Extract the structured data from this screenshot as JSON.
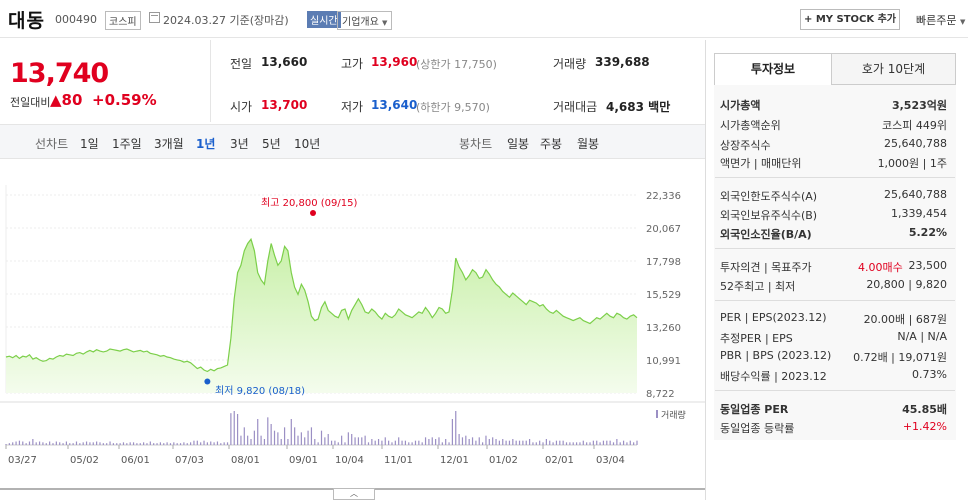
{
  "header": {
    "title": "대동",
    "code": "000490",
    "market": "코스피",
    "date": "2024.03.27 기준(장마감)",
    "realtime": "실시간",
    "overview": "기업개요",
    "my_stock": "+ MY STOCK 추가",
    "quick_order": "빠른주문"
  },
  "quote": {
    "price": "13,740",
    "change_label": "전일대비",
    "change_value": "▲80",
    "change_pct": "+0.59%",
    "prev_close_label": "전일",
    "prev_close": "13,660",
    "high_label": "고가",
    "high": "13,960",
    "upper_limit": "(상한가 17,750)",
    "volume_label": "거래량",
    "volume": "339,688",
    "open_label": "시가",
    "open": "13,700",
    "low_label": "저가",
    "low": "13,640",
    "lower_limit": "(하한가 9,570)",
    "amount_label": "거래대금",
    "amount": "4,683",
    "amount_unit": "백만"
  },
  "periods": {
    "line_label": "선차트",
    "line_items": [
      "1일",
      "1주일",
      "3개월",
      "1년",
      "3년",
      "5년",
      "10년"
    ],
    "selected": "1년",
    "candle_label": "봉차트",
    "candle_items": [
      "일봉",
      "주봉",
      "월봉"
    ]
  },
  "chart_data": {
    "type": "area",
    "y_ticks": [
      "22,336",
      "20,067",
      "17,798",
      "15,529",
      "13,260",
      "10,991",
      "8,722"
    ],
    "ylim": [
      8722,
      22336
    ],
    "x_ticks": [
      "03/27",
      "05/02",
      "06/01",
      "07/03",
      "08/01",
      "09/01",
      "10/04",
      "11/01",
      "12/01",
      "01/02",
      "02/01",
      "03/04"
    ],
    "annotation_high": "최고 20,800 (09/15)",
    "annotation_low": "최저 9,820 (08/18)",
    "volume_label": "거래량",
    "values": [
      11200,
      11250,
      11150,
      11300,
      11100,
      11250,
      11200,
      11350,
      11050,
      11150,
      11000,
      10900,
      10950,
      11100,
      11050,
      11200,
      11300,
      11250,
      11400,
      11350,
      11300,
      11450,
      11500,
      11400,
      11550,
      11650,
      11550,
      11700,
      11600,
      11550,
      11600,
      11750,
      11700,
      11650,
      11600,
      11700,
      11750,
      11650,
      11550,
      11600,
      11650,
      11550,
      11600,
      11450,
      11400,
      11350,
      11250,
      11300,
      11200,
      11150,
      11050,
      11000,
      10950,
      10850,
      10900,
      10800,
      10600,
      10400,
      10500,
      10300,
      10200,
      10350,
      10250,
      10400,
      10450,
      10550,
      10650,
      12500,
      15200,
      17000,
      17500,
      18500,
      19000,
      19300,
      18500,
      17000,
      16500,
      16200,
      17800,
      19000,
      18200,
      17500,
      17800,
      18800,
      18500,
      17000,
      16000,
      15500,
      16200,
      15800,
      15000,
      14000,
      13700,
      13800,
      14600,
      15000,
      14400,
      14200,
      14000,
      13900,
      14400,
      14500,
      13800,
      14400,
      14800,
      15200,
      14800,
      14300,
      14200,
      14500,
      14300,
      14000,
      13800,
      14200,
      14000,
      13900,
      14100,
      14500,
      14300,
      14100,
      14000,
      13900,
      14100,
      14300,
      14200,
      14600,
      14300,
      13900,
      14200,
      14600,
      14500,
      14200,
      14300,
      15800,
      18000,
      17400,
      17000,
      16500,
      16800,
      17200,
      17000,
      16600,
      16700,
      17200,
      16900,
      16500,
      16200,
      16000,
      15700,
      15500,
      15300,
      15600,
      15400,
      15200,
      15000,
      14800,
      15100,
      15000,
      14900,
      14700,
      14800,
      14500,
      14300,
      14200,
      14400,
      14200,
      14000,
      13900,
      13800,
      13700,
      13800,
      13900,
      13700,
      13600,
      13500,
      13700,
      13900,
      13800,
      14000,
      14200,
      14000,
      13900,
      14200,
      14100,
      13900,
      13800,
      14000,
      14100,
      13900
    ]
  },
  "tabs": {
    "invest_info": "투자정보",
    "order_book": "호가 10단계"
  },
  "info": {
    "market_cap_label": "시가총액",
    "market_cap": "3,523억원",
    "market_cap_rank_label": "시가총액순위",
    "market_cap_rank": "코스피 449위",
    "shares_label": "상장주식수",
    "shares": "25,640,788",
    "par_label": "액면가 | 매매단위",
    "par": "1,000원 | 1주",
    "foreign_limit_label": "외국인한도주식수(A)",
    "foreign_limit": "25,640,788",
    "foreign_hold_label": "외국인보유주식수(B)",
    "foreign_hold": "1,339,454",
    "foreign_ratio_label": "외국인소진율(B/A)",
    "foreign_ratio": "5.22%",
    "opinion_label": "투자의견 | 목표주가",
    "opinion": "4.00매수",
    "target": "23,500",
    "w52_label": "52주최고 | 최저",
    "w52": "20,800 | 9,820",
    "per_label": "PER | EPS(2023.12)",
    "per": "20.00배 | 687원",
    "est_per_label": "추정PER | EPS",
    "est_per": "N/A | N/A",
    "pbr_label": "PBR | BPS (2023.12)",
    "pbr": "0.72배 | 19,071원",
    "div_label": "배당수익률 | 2023.12",
    "div": "0.73%",
    "sector_per_label": "동일업종 PER",
    "sector_per": "45.85배",
    "sector_chg_label": "동일업종 등락률",
    "sector_chg": "+1.42%"
  }
}
